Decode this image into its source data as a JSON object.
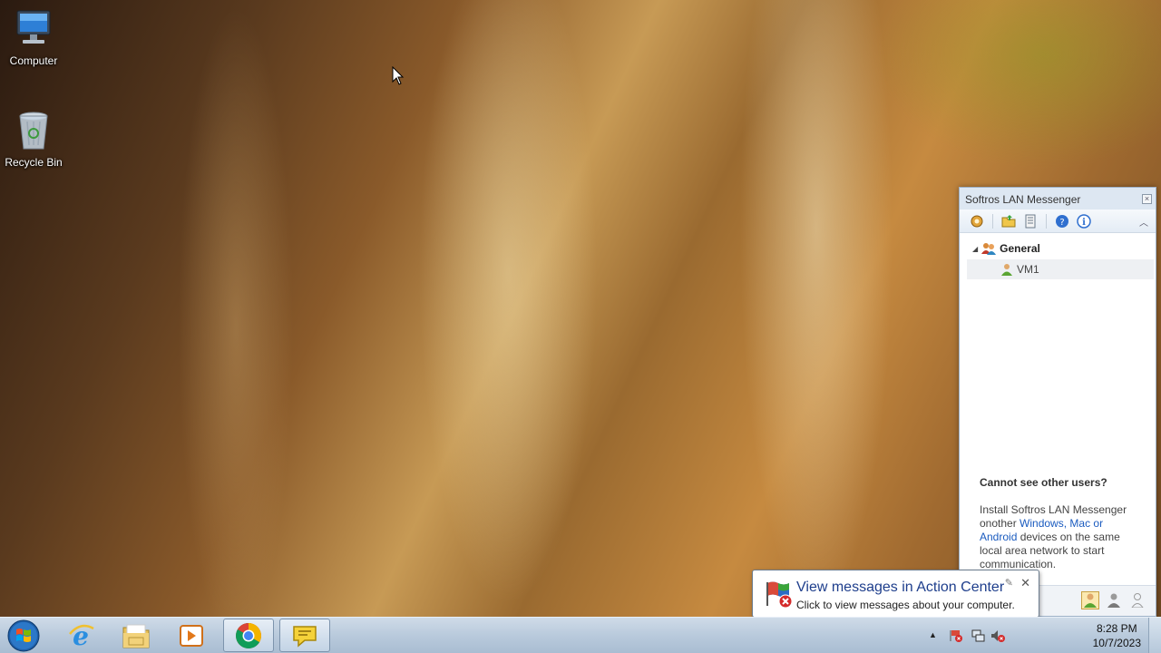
{
  "desktop": {
    "icons": [
      {
        "label": "Computer"
      },
      {
        "label": "Recycle Bin"
      }
    ]
  },
  "messenger": {
    "title": "Softros LAN Messenger",
    "group": "General",
    "users": [
      "VM1"
    ],
    "help_heading": "Cannot see other users?",
    "help_text_1": "Install Softros LAN Messenger onother ",
    "help_link": "Windows, Mac or Android",
    "help_text_2": " devices on the same local area network to start communication."
  },
  "balloon": {
    "title": "View messages in Action Center",
    "body": "Click to view messages about your computer."
  },
  "taskbar": {
    "apps": [
      "internet-explorer",
      "windows-explorer",
      "media-player",
      "chrome",
      "lan-messenger"
    ],
    "clock_time": "8:28 PM",
    "clock_date": "10/7/2023"
  },
  "colors": {
    "taskbar": "#b9cadc",
    "link": "#1a5bbf",
    "balloon_title": "#1e3e8c"
  }
}
